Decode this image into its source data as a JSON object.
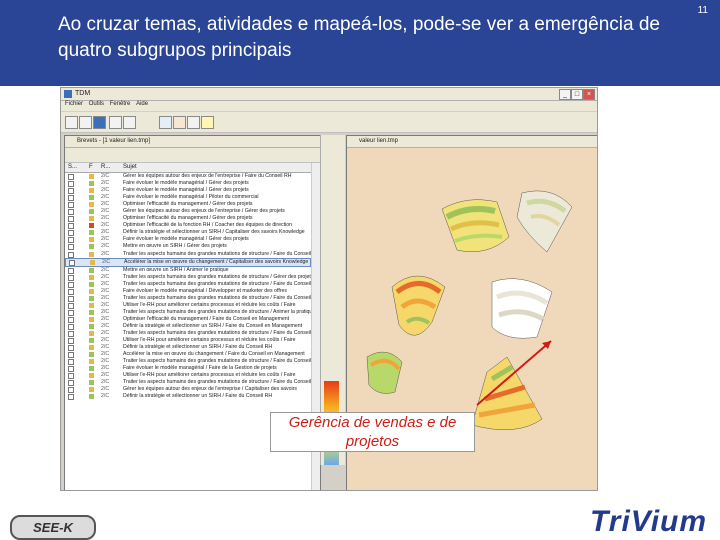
{
  "header": {
    "slide_number": "11",
    "title": "Ao cruzar temas, atividades e mapeá-los, pode-se ver a emergência de quatro subgrupos principais"
  },
  "app": {
    "title": "TDM",
    "menu": [
      "Fichier",
      "Outils",
      "Fenêtre",
      "Aide"
    ],
    "list_window_title": "Brevets - [1 valeur lien.tmp]",
    "map_window_title": "valeur lien.tmp",
    "columns": [
      "S...",
      "F",
      "R...",
      "Sujet"
    ],
    "rows": [
      {
        "code": "2/C",
        "text": "Gérer les équipes autour des enjeux de l'entreprise / Faire du Conseil RH",
        "color": "#e6b84a"
      },
      {
        "code": "2/C",
        "text": "Faire évoluer le modèle managérial / Gérer des projets",
        "color": "#9ec35a"
      },
      {
        "code": "2/C",
        "text": "Faire évoluer le modèle managérial / Gérer des projets",
        "color": "#e6b84a"
      },
      {
        "code": "2/C",
        "text": "Faire évoluer le modèle managérial / Piloter du commercial",
        "color": "#9ec35a"
      },
      {
        "code": "2/C",
        "text": "Optimiser l'efficacité du management / Gérer des projets",
        "color": "#e6b84a"
      },
      {
        "code": "2/C",
        "text": "Gérer les équipes autour des enjeux de l'entreprise / Gérer des projets",
        "color": "#9ec35a"
      },
      {
        "code": "2/C",
        "text": "Optimiser l'efficacité du management / Gérer des projets",
        "color": "#e6b84a"
      },
      {
        "code": "2/C",
        "text": "Optimiser l'efficacité de la fonction RH / Coacher des équipes de direction",
        "color": "#d04a2a"
      },
      {
        "code": "2/C",
        "text": "Définir la stratégie et sélectionner un SIRH / Capitaliser des savoirs Knowledge",
        "color": "#9ec35a"
      },
      {
        "code": "2/C",
        "text": "Faire évoluer le modèle managérial / Gérer des projets",
        "color": "#e6b84a"
      },
      {
        "code": "2/C",
        "text": "Mettre en œuvre un SIRH / Gérer des projets",
        "color": "#9ec35a"
      },
      {
        "code": "2/C",
        "text": "Traiter les aspects humains des grandes mutations de structure / Faire du Conseil RH",
        "color": "#e6b84a"
      },
      {
        "code": "2/C",
        "text": "Accélérer la mise en œuvre du changement / Capitaliser des savoirs Knowledge Mgt",
        "color": "#e6b84a",
        "selected": true
      },
      {
        "code": "2/C",
        "text": "Mettre en œuvre un SIRH / Animer le pratique",
        "color": "#9ec35a"
      },
      {
        "code": "2/C",
        "text": "Traiter les aspects humains des grandes mutations de structure / Gérer des projets",
        "color": "#e6b84a"
      },
      {
        "code": "2/C",
        "text": "Traiter les aspects humains des grandes mutations de structure / Faire du Conseil",
        "color": "#9ec35a"
      },
      {
        "code": "2/C",
        "text": "Faire évoluer le modèle managérial / Développer et marketer des offres",
        "color": "#e6b84a"
      },
      {
        "code": "2/C",
        "text": "Traiter les aspects humains des grandes mutations de structure / Faire du Conseil",
        "color": "#9ec35a"
      },
      {
        "code": "2/C",
        "text": "Utiliser l'e-RH pour améliorer certains processus et réduire les coûts / Faire",
        "color": "#e6b84a"
      },
      {
        "code": "2/C",
        "text": "Traiter les aspects humains des grandes mutations de structure / Animer la pratique",
        "color": "#9ec35a"
      },
      {
        "code": "2/C",
        "text": "Optimiser l'efficacité du management / Faire du Conseil en Management",
        "color": "#e6b84a"
      },
      {
        "code": "2/C",
        "text": "Définir la stratégie et sélectionner un SIRH / Faire du Conseil en Management",
        "color": "#9ec35a"
      },
      {
        "code": "2/C",
        "text": "Traiter les aspects humains des grandes mutations de structure / Faire du Conseil",
        "color": "#e6b84a"
      },
      {
        "code": "2/C",
        "text": "Utiliser l'e-RH pour améliorer certains processus et réduire les coûts / Faire",
        "color": "#9ec35a"
      },
      {
        "code": "2/C",
        "text": "Définir la stratégie et sélectionner un SIRH / Faire du Conseil RH",
        "color": "#e6b84a"
      },
      {
        "code": "2/C",
        "text": "Accélérer la mise en œuvre du changement / Faire du Conseil en Management",
        "color": "#9ec35a"
      },
      {
        "code": "2/C",
        "text": "Traiter les aspects humains des grandes mutations de structure / Faire du Conseil",
        "color": "#e6b84a"
      },
      {
        "code": "2/C",
        "text": "Faire évoluer le modèle managérial / Faire de la Gestion de projets",
        "color": "#9ec35a"
      },
      {
        "code": "2/C",
        "text": "Utiliser l'e-RH pour améliorer certains processus et réduire les coûts / Faire",
        "color": "#e6b84a"
      },
      {
        "code": "2/C",
        "text": "Traiter les aspects humains des grandes mutations de structure / Faire du Conseil",
        "color": "#9ec35a"
      },
      {
        "code": "2/C",
        "text": "Gérer les équipes autour des enjeux de l'entreprise / Capitaliser des savoirs",
        "color": "#e6b84a"
      },
      {
        "code": "2/C",
        "text": "Définir la stratégie et sélectionner un SIRH / Faire du Conseil RH",
        "color": "#9ec35a"
      }
    ]
  },
  "label": "Gerência de vendas e de projetos",
  "footer": {
    "left_logo": "SEE-K",
    "right_logo": "TriVium"
  }
}
